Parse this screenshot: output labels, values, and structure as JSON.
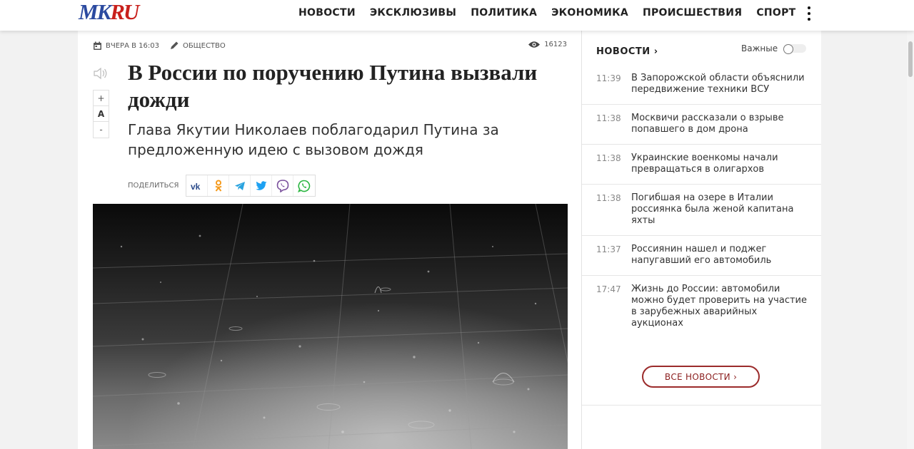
{
  "header": {
    "logo_left": "MK",
    "logo_right": "RU",
    "nav": [
      "НОВОСТИ",
      "ЭКСКЛЮЗИВЫ",
      "ПОЛИТИКА",
      "ЭКОНОМИКА",
      "ПРОИСШЕСТВИЯ",
      "СПОРТ"
    ],
    "more_icon": "kebab-menu-icon"
  },
  "article": {
    "date": "ВЧЕРА В 16:03",
    "rubric": "ОБЩЕСТВО",
    "views": "16123",
    "font_controls": [
      "+",
      "A",
      "-"
    ],
    "title": "В России по поручению Путина вызвали дожди",
    "subtitle": "Глава Якутии Николаев поблагодарил Путина за предложенную идею с вызовом дождя",
    "share_label": "поделиться",
    "share_icons": [
      "vk-icon",
      "odnoklassniki-icon",
      "telegram-icon",
      "twitter-icon",
      "viber-icon",
      "whatsapp-icon"
    ]
  },
  "sidebar": {
    "heading": "НОВОСТИ ›",
    "important_label": "Важные",
    "important_on": false,
    "items": [
      {
        "time": "11:39",
        "text": "В Запорожской области объяснили передвижение техники ВСУ"
      },
      {
        "time": "11:38",
        "text": "Москвичи рассказали о взрыве попавшего в дом дрона"
      },
      {
        "time": "11:38",
        "text": "Украинские военкомы начали превращаться в олигархов"
      },
      {
        "time": "11:38",
        "text": "Погибшая на озере в Италии россиянка была женой капитана яхты"
      },
      {
        "time": "11:37",
        "text": "Россиянин нашел и поджег напугавший его автомобиль"
      },
      {
        "time": "17:47",
        "text": "Жизнь до России: автомобили можно будет проверить на участие в зарубежных аварийных аукционах"
      }
    ],
    "all_news": "ВСЕ НОВОСТИ ›"
  },
  "colors": {
    "logo_blue": "#2b4aa0",
    "logo_red": "#c8201c",
    "accent_maroon": "#9b2b2b"
  }
}
